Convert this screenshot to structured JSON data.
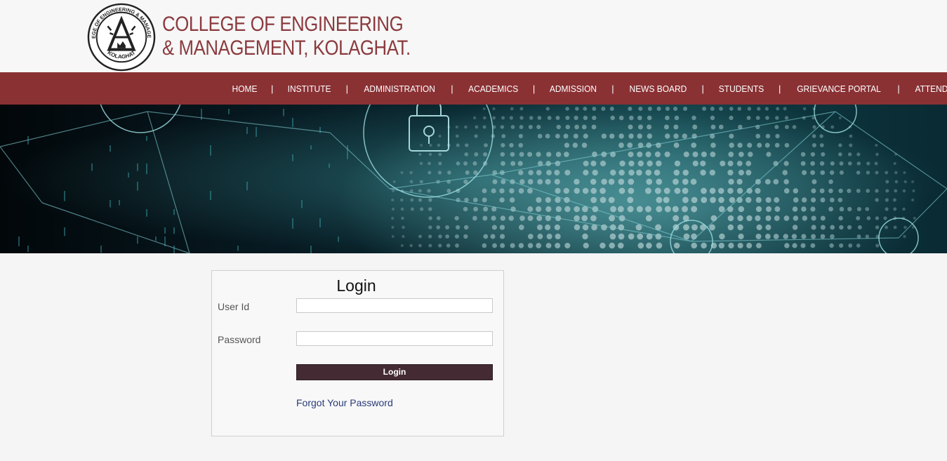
{
  "header": {
    "logo_seal_text_top": "COLLEGE OF ENGINEERING & MANAGEMENT",
    "logo_seal_text_bottom": "KOLAGHAT",
    "title_line1": "COLLEGE OF ENGINEERING",
    "title_line2": "& MANAGEMENT, KOLAGHAT.",
    "brand_color": "#8b3a3e"
  },
  "nav": {
    "separator": "|",
    "items": [
      {
        "label": "HOME"
      },
      {
        "label": "INSTITUTE"
      },
      {
        "label": "ADMINISTRATION"
      },
      {
        "label": "ACADEMICS"
      },
      {
        "label": "ADMISSION"
      },
      {
        "label": "NEWS BOARD"
      },
      {
        "label": "STUDENTS"
      },
      {
        "label": "GRIEVANCE PORTAL"
      },
      {
        "label": "ATTENDANCE"
      }
    ],
    "bar_color": "#8a3134"
  },
  "banner": {
    "theme": "cyber-security-network-background"
  },
  "login": {
    "title": "Login",
    "user_id_label": "User Id",
    "user_id_value": "",
    "password_label": "Password",
    "password_value": "",
    "button_label": "Login",
    "forgot_link": "Forgot Your Password",
    "button_color": "#432a33"
  }
}
